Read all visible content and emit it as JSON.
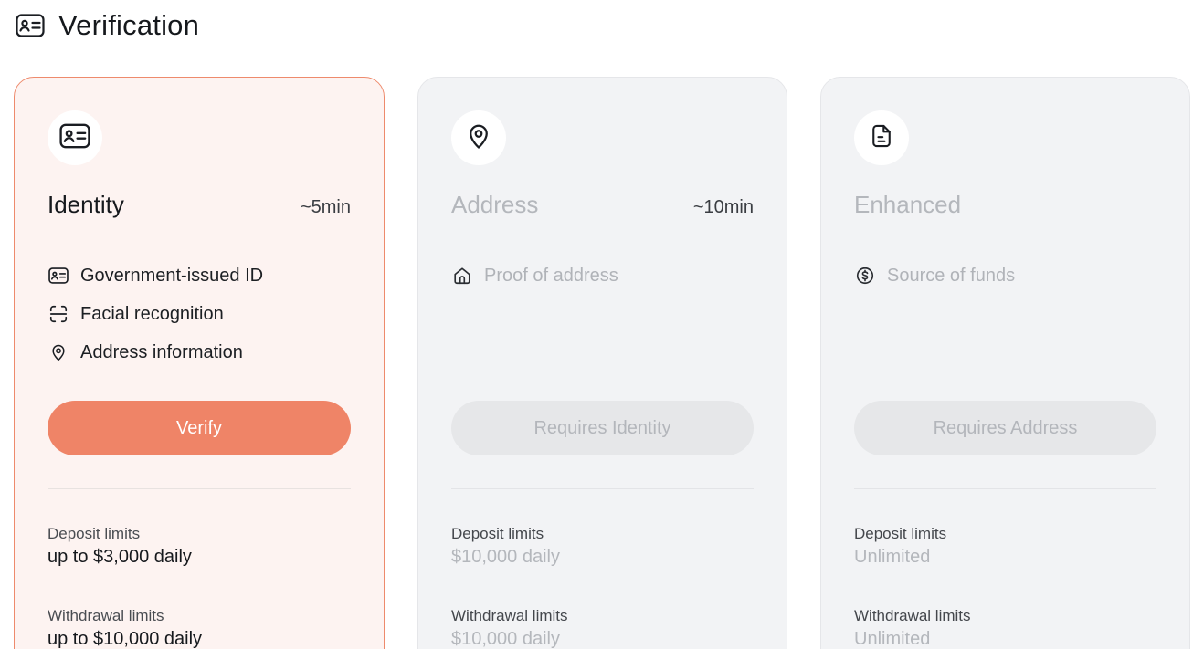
{
  "header": {
    "title": "Verification",
    "icon": "id-card-icon"
  },
  "cards": [
    {
      "title": "Identity",
      "duration": "~5min",
      "icon": "id-card-icon",
      "state": "active",
      "features": [
        {
          "label": "Government-issued ID",
          "icon": "id-card-icon"
        },
        {
          "label": "Facial recognition",
          "icon": "face-scan-icon"
        },
        {
          "label": "Address information",
          "icon": "location-pin-icon"
        }
      ],
      "button_label": "Verify",
      "deposit": {
        "label": "Deposit limits",
        "value": "up to $3,000 daily"
      },
      "withdrawal": {
        "label": "Withdrawal limits",
        "value": "up to $10,000 daily"
      }
    },
    {
      "title": "Address",
      "duration": "~10min",
      "icon": "location-pin-icon",
      "state": "disabled",
      "features": [
        {
          "label": "Proof of address",
          "icon": "home-icon"
        }
      ],
      "button_label": "Requires Identity",
      "deposit": {
        "label": "Deposit limits",
        "value": "$10,000 daily"
      },
      "withdrawal": {
        "label": "Withdrawal limits",
        "value": "$10,000 daily"
      }
    },
    {
      "title": "Enhanced",
      "duration": "",
      "icon": "document-icon",
      "state": "disabled",
      "features": [
        {
          "label": "Source of funds",
          "icon": "dollar-coin-icon"
        }
      ],
      "button_label": "Requires Address",
      "deposit": {
        "label": "Deposit limits",
        "value": "Unlimited"
      },
      "withdrawal": {
        "label": "Withdrawal limits",
        "value": "Unlimited"
      }
    }
  ],
  "colors": {
    "accent": "#ef8467",
    "active_card_bg": "#fdf3f1",
    "active_card_border": "#ee8a6c",
    "disabled_card_bg": "#f2f3f5",
    "disabled_text": "#b4b7bc"
  }
}
